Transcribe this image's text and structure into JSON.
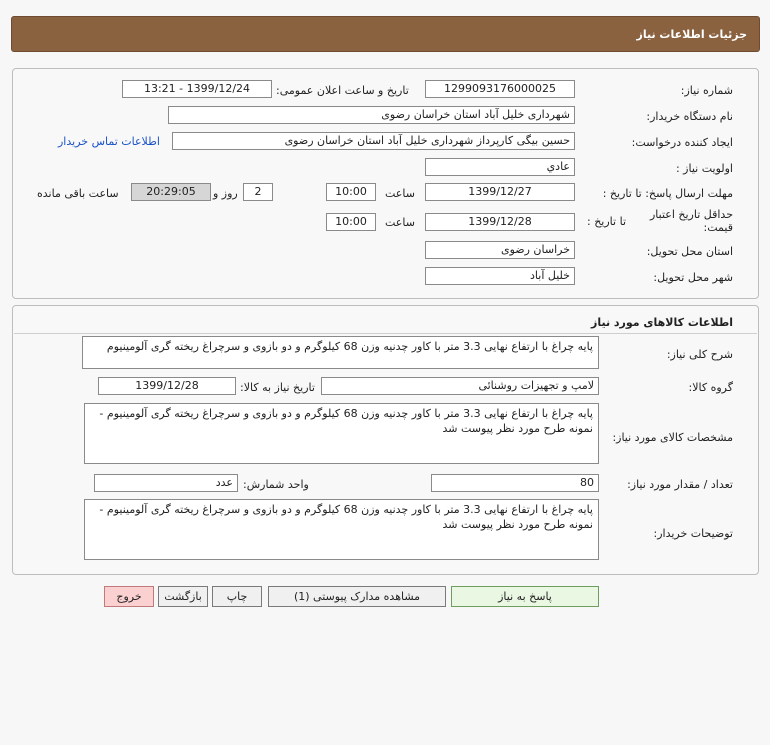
{
  "page_title": "جزئیات اطلاعات نیاز",
  "info": {
    "need_number_label": "شماره نیاز:",
    "need_number": "1299093176000025",
    "announce_label": "تاریخ و ساعت اعلان عمومی:",
    "announce_value": "1399/12/24 - 13:21",
    "buyer_org_label": "نام دستگاه خریدار:",
    "buyer_org": "شهرداری خلیل آباد استان خراسان رضوی",
    "requester_label": "ایجاد کننده درخواست:",
    "requester": "حسین بیگی کارپرداز شهرداری خلیل آباد استان خراسان رضوی",
    "contact_link": "اطلاعات تماس خریدار",
    "priority_label": "اولویت نیاز :",
    "priority": "عادي",
    "deadline_label": "مهلت ارسال پاسخ: تا تاریخ :",
    "deadline_date": "1399/12/27",
    "time_label": "ساعت",
    "deadline_time": "10:00",
    "days_value": "2",
    "days_label": "روز و",
    "remaining_time": "20:29:05",
    "remaining_label": "ساعت باقی مانده",
    "validity_label_1": "حداقل تاریخ اعتبار",
    "validity_label_2": "قیمت:",
    "validity_to_label": "تا تاریخ :",
    "validity_date": "1399/12/28",
    "validity_time": "10:00",
    "province_label": "استان محل تحویل:",
    "province": "خراسان رضوی",
    "city_label": "شهر محل تحویل:",
    "city": "خلیل آباد"
  },
  "goods": {
    "section_title": "اطلاعات کالاهای مورد نیاز",
    "summary_label": "شرح کلی نیاز:",
    "summary": "پایه چراغ با ارتفاع نهایی 3.3 متر با کاور چدنیه وزن 68 کیلوگرم و دو بازوی و سرچراغ  ریخته گری آلومینیوم",
    "group_label": "گروه کالا:",
    "group": "لامپ و تجهیزات روشنائی",
    "need_date_label": "تاریخ نیاز به کالا:",
    "need_date": "1399/12/28",
    "specs_label": "مشخصات کالای مورد نیاز:",
    "specs": "پایه چراغ با ارتفاع نهایی 3.3 متر با کاور چدنیه وزن 68 کیلوگرم و دو بازوی و سرچراغ  ریخته گری آلومینیوم - نمونه طرح مورد نظر پیوست شد",
    "qty_label": "تعداد / مقدار مورد نیاز:",
    "qty": "80",
    "unit_label": "واحد شمارش:",
    "unit": "عدد",
    "buyer_notes_label": "توضیحات خریدار:",
    "buyer_notes": "پایه چراغ با ارتفاع نهایی 3.3 متر با کاور چدنیه وزن 68 کیلوگرم و دو بازوی و سرچراغ  ریخته گری آلومینیوم - نمونه طرح مورد نظر پیوست شد"
  },
  "buttons": {
    "respond": "پاسخ به نیاز",
    "attachments": "مشاهده مدارک پیوستی (1)",
    "print": "چاپ",
    "back": "بازگشت",
    "exit": "خروج"
  }
}
